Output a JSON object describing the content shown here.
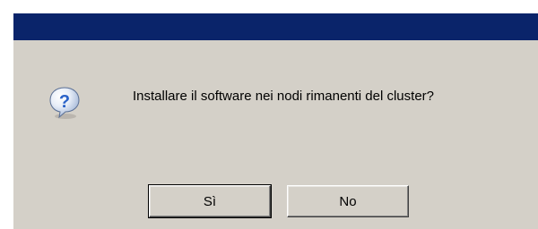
{
  "dialog": {
    "message": "Installare il software nei nodi rimanenti del cluster?",
    "icon": "question-icon"
  },
  "buttons": {
    "yes_label": "Sì",
    "no_label": "No"
  },
  "colors": {
    "titlebar": "#0a246a",
    "dialog_background": "#d4d0c8",
    "icon_blue": "#2a62c8"
  }
}
